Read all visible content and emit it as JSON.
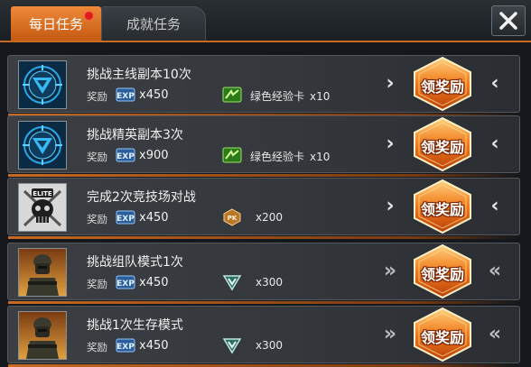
{
  "tabs": [
    {
      "label": "每日任务",
      "active": true,
      "has_notification": true
    },
    {
      "label": "成就任务",
      "active": false
    }
  ],
  "accent_color": "#e07a2a",
  "notification_color": "#e21c1c",
  "reward_prefix": "奖励",
  "claim_label": "领奖励",
  "tasks": [
    {
      "title": "挑战主线副本10次",
      "thumb": "blue-v-emblem-icon",
      "exp_amount": "x450",
      "item": {
        "icon": "green-exp-card-icon",
        "name": "绿色经验卡",
        "qty": "x10"
      },
      "left_arrow": "›",
      "right_arrow": "‹"
    },
    {
      "title": "挑战精英副本3次",
      "thumb": "blue-v-emblem-icon",
      "exp_amount": "x900",
      "item": {
        "icon": "green-exp-card-icon",
        "name": "绿色经验卡",
        "qty": "x10"
      },
      "left_arrow": "›",
      "right_arrow": "‹"
    },
    {
      "title": "完成2次竞技场对战",
      "thumb": "elite-skull-emblem-icon",
      "exp_amount": "x450",
      "item": {
        "icon": "pk-medal-icon",
        "name": "",
        "qty": "x200"
      },
      "left_arrow": "›",
      "right_arrow": "‹"
    },
    {
      "title": "挑战组队模式1次",
      "thumb": "soldier-portrait-icon",
      "exp_amount": "x450",
      "item": {
        "icon": "teal-chevron-badge-icon",
        "name": "",
        "qty": "x300"
      },
      "left_arrow": "»",
      "right_arrow": "«"
    },
    {
      "title": "挑战1次生存模式",
      "thumb": "soldier-portrait-icon",
      "exp_amount": "x450",
      "item": {
        "icon": "teal-chevron-badge-icon",
        "name": "",
        "qty": "x300"
      },
      "left_arrow": "»",
      "right_arrow": "«"
    }
  ]
}
